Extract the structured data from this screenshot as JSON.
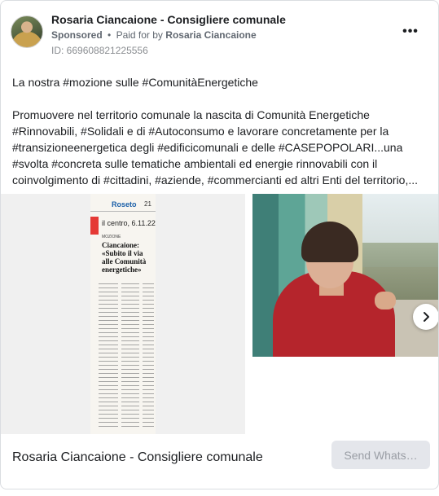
{
  "ad": {
    "page_name": "Rosaria Ciancaione - Consigliere comunale",
    "sponsored_label": "Sponsored",
    "separator": "•",
    "paid_for_prefix": "Paid for by",
    "paid_for_by": "Rosaria Ciancaione",
    "ad_id": "ID: 669608821225556",
    "more_icon": "more-horizontal-icon",
    "more_label": "•••"
  },
  "post": {
    "line1": "La nostra #mozione sulle #ComunitàEnergetiche",
    "paragraph": [
      "Promuovere nel territorio comunale la nascita di Comunità Energetiche",
      "#Rinnovabili, #Solidali e di #Autoconsumo e lavorare concretamente per la",
      "#transizioneenergetica degli #edificicomunali e delle #CASEPOPOLARI...una",
      "#svolta #concreta sulle tematiche ambientali ed energie rinnovabili con il",
      "coinvolgimento di #cittadini, #aziende, #commercianti ed altri Enti del territorio,..."
    ]
  },
  "carousel": {
    "slide1": {
      "masthead_city": "Roseto",
      "page_number": "21",
      "dateline": "il centro, 6.11.22",
      "kicker": "MOZIONE",
      "headline": "Ciancaione: «Subito il via alle Comunità energetiche»"
    },
    "next_icon": "chevron-right-icon"
  },
  "footer": {
    "title": "Rosaria Ciancaione - Consigliere comunale",
    "cta_label": "Send Whats…"
  },
  "colors": {
    "cta_bg": "#e4e6eb",
    "cta_text": "#9a9ea5",
    "border": "#dadde1",
    "text": "#1c1e21",
    "secondary_text": "#606770"
  }
}
